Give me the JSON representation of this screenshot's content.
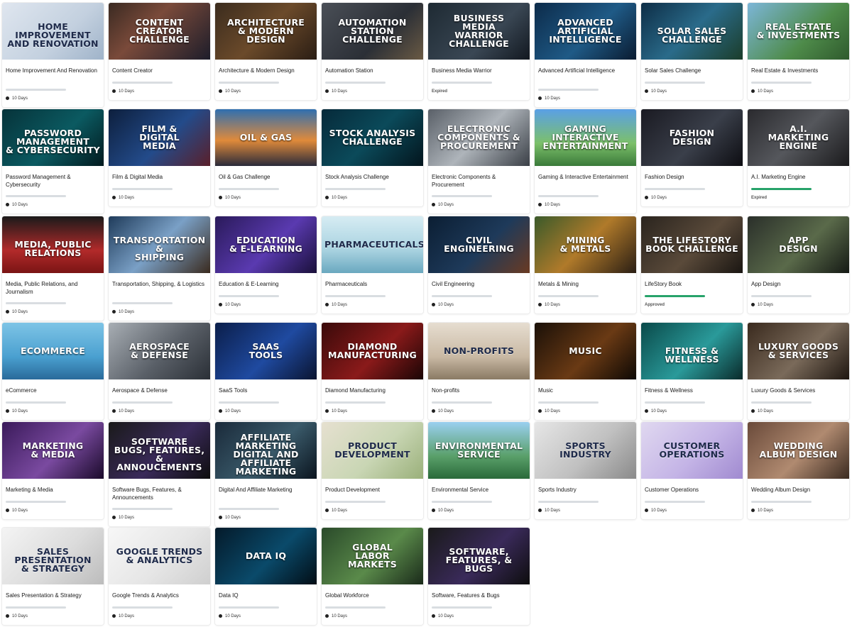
{
  "cards": [
    {
      "title": "Home Improvement And Renovation",
      "thumb": "Home Improvement\nand Renovation",
      "meta": "10 Days",
      "icon": "timer-icon",
      "progress": 0,
      "bg": "linear-gradient(135deg,#dfe6ef 0%,#c3d0df 60%,#9fb3c9 100%)",
      "dark": true
    },
    {
      "title": "Content Creator",
      "thumb": "Content\nCreator\nChallenge",
      "meta": "10 Days",
      "icon": "timer-icon",
      "progress": 0,
      "bg": "linear-gradient(135deg,#3a2a22 0%,#7a4a3a 40%,#1d1d2a 100%)"
    },
    {
      "title": "Architecture & Modern Design",
      "thumb": "Architecture\n& Modern\nDesign",
      "meta": "10 Days",
      "icon": "timer-icon",
      "progress": 0,
      "bg": "linear-gradient(135deg,#3b2c1e 0%,#6b4a2a 50%,#2a1d14 100%)"
    },
    {
      "title": "Automation Station",
      "thumb": "Automation\nStation\nChallenge",
      "meta": "10 Days",
      "icon": "timer-icon",
      "progress": 0,
      "bg": "linear-gradient(135deg,#4a4f57 0%,#2b2f36 60%,#6a5a44 100%)"
    },
    {
      "title": "Business Media Warrior",
      "thumb": "Business\nMedia\nWarrior\nChallenge",
      "meta": "Expired",
      "icon": "",
      "progress": 0,
      "bg": "linear-gradient(135deg,#1e2a33 0%,#3a4754 60%,#121820 100%)"
    },
    {
      "title": "Advanced Artificial Intelligence",
      "thumb": "Advanced\nArtificial\nIntelligence",
      "meta": "10 Days",
      "icon": "timer-icon",
      "progress": 0,
      "bg": "linear-gradient(135deg,#0c2b4a 0%,#1f5a86 55%,#0a1b30 100%)"
    },
    {
      "title": "Solar Sales Challenge",
      "thumb": "Solar Sales Challenge",
      "meta": "10 Days",
      "icon": "timer-icon",
      "progress": 0,
      "bg": "linear-gradient(135deg,#0d2d46 0%,#2a6b8a 50%,#1b3d2a 100%)"
    },
    {
      "title": "Real Estate & Investments",
      "thumb": "Real Estate\n& Investments",
      "meta": "10 Days",
      "icon": "timer-icon",
      "progress": 0,
      "bg": "linear-gradient(135deg,#7cb6d8 0%,#4e8b4a 60%,#2f5a2d 100%)"
    },
    {
      "title": "Password Management & Cybersecurity",
      "thumb": "Password Management\n& Cybersecurity",
      "meta": "10 Days",
      "icon": "timer-icon",
      "progress": 0,
      "bg": "linear-gradient(135deg,#06333a 0%,#0b5a61 55%,#021a1e 100%)"
    },
    {
      "title": "Film & Digital Media",
      "thumb": "Film &\nDigital\nMedia",
      "meta": "10 Days",
      "icon": "timer-icon",
      "progress": 0,
      "bg": "linear-gradient(135deg,#0d1f3d 0%,#234b8a 55%,#5a1f2a 100%)"
    },
    {
      "title": "Oil & Gas Challenge",
      "thumb": "Oil & Gas",
      "meta": "10 Days",
      "icon": "timer-icon",
      "progress": 0,
      "bg": "linear-gradient(180deg,#2f6fb0 0%,#e08a3a 55%,#2a2a3a 100%)"
    },
    {
      "title": "Stock Analysis Challenge",
      "thumb": "Stock Analysis\nChallenge",
      "meta": "10 Days",
      "icon": "timer-icon",
      "progress": 0,
      "bg": "linear-gradient(135deg,#062a3a 0%,#0b4a5a 50%,#03151d 100%)"
    },
    {
      "title": "Electronic Components & Procurement",
      "thumb": "Electronic\nComponents &\nProcurement",
      "meta": "10 Days",
      "icon": "timer-icon",
      "progress": 0,
      "bg": "linear-gradient(135deg,#5a6068 0%,#aeb4ba 50%,#3a3f46 100%)"
    },
    {
      "title": "Gaming & Interactive Entertainment",
      "thumb": "Gaming\nInteractive\nEntertainment",
      "meta": "10 Days",
      "icon": "timer-icon",
      "progress": 0,
      "bg": "linear-gradient(180deg,#5aa0e6 0%,#7cc06a 60%,#3a7a3a 100%)"
    },
    {
      "title": "Fashion Design",
      "thumb": "Fashion\nDesign",
      "meta": "10 Days",
      "icon": "timer-icon",
      "progress": 0,
      "bg": "linear-gradient(135deg,#1a1a22 0%,#3a3f4a 55%,#0d0d12 100%)"
    },
    {
      "title": "A.I. Marketing Engine",
      "thumb": "A.I.\nMarketing\nEngine",
      "meta": "Expired",
      "icon": "",
      "progress": 1,
      "bg": "linear-gradient(135deg,#2a2a2e 0%,#55575c 50%,#1a1a1c 100%)"
    },
    {
      "title": "Media, Public Relations, and Journalism",
      "thumb": "Media, Public Relations",
      "meta": "10 Days",
      "icon": "timer-icon",
      "progress": 0,
      "bg": "linear-gradient(180deg,#1a1a1a 0%,#b22a2a 60%,#7a1414 100%)"
    },
    {
      "title": "Transportation, Shipping, & Logistics",
      "thumb": "Transportation &\nShipping",
      "meta": "10 Days",
      "icon": "timer-icon",
      "progress": 0,
      "bg": "linear-gradient(135deg,#1f3b5a 0%,#7aa0c6 50%,#3a2a1e 100%)"
    },
    {
      "title": "Education & E-Learning",
      "thumb": "Education\n& E-Learning",
      "meta": "10 Days",
      "icon": "timer-icon",
      "progress": 0,
      "bg": "linear-gradient(135deg,#2a1a5a 0%,#5a3ab0 55%,#1a103a 100%)"
    },
    {
      "title": "Pharmaceuticals",
      "thumb": "Pharmaceuticals",
      "meta": "10 Days",
      "icon": "timer-icon",
      "progress": 0,
      "bg": "linear-gradient(180deg,#d6ecf3 0%,#a8d2e0 60%,#6aa8bf 100%)",
      "dark": true
    },
    {
      "title": "Civil Engineering",
      "thumb": "Civil\nEngineering",
      "meta": "10 Days",
      "icon": "timer-icon",
      "progress": 0,
      "bg": "linear-gradient(135deg,#0b1e33 0%,#1e3a5a 55%,#6a3a22 100%)"
    },
    {
      "title": "Metals & Mining",
      "thumb": "Mining\n& Metals",
      "meta": "10 Days",
      "icon": "timer-icon",
      "progress": 0,
      "bg": "linear-gradient(135deg,#3a5a2a 0%,#b07a2a 50%,#2a1e14 100%)"
    },
    {
      "title": "LifeStory Book",
      "thumb": "The LifeStory\nBook Challenge",
      "meta": "Approved",
      "icon": "",
      "progress": 1,
      "bg": "linear-gradient(135deg,#2a241e 0%,#5a4a3a 55%,#1a1612 100%)"
    },
    {
      "title": "App Design",
      "thumb": "App\nDesign",
      "meta": "10 Days",
      "icon": "timer-icon",
      "progress": 0,
      "bg": "linear-gradient(135deg,#2a2f2a 0%,#5a6a4a 55%,#151a15 100%)"
    },
    {
      "title": "eCommerce",
      "thumb": "eCommerce",
      "meta": "10 Days",
      "icon": "timer-icon",
      "progress": 0,
      "bg": "linear-gradient(180deg,#7ec4e6 0%,#4aa0d0 60%,#2a6a9a 100%)"
    },
    {
      "title": "Aerospace & Defense",
      "thumb": "Aerospace\n& Defense",
      "meta": "10 Days",
      "icon": "timer-icon",
      "progress": 0,
      "bg": "linear-gradient(135deg,#a8aeb4 0%,#5a6068 55%,#2a2f36 100%)"
    },
    {
      "title": "SaaS Tools",
      "thumb": "SaaS\nTools",
      "meta": "10 Days",
      "icon": "timer-icon",
      "progress": 0,
      "bg": "linear-gradient(135deg,#0b1e4a 0%,#1f4aa0 55%,#0a1430 100%)"
    },
    {
      "title": "Diamond Manufacturing",
      "thumb": "Diamond\nManufacturing",
      "meta": "10 Days",
      "icon": "timer-icon",
      "progress": 0,
      "bg": "linear-gradient(135deg,#3a0a0a 0%,#8a1a1a 55%,#1a0505 100%)"
    },
    {
      "title": "Non-profits",
      "thumb": "Non-Profits",
      "meta": "10 Days",
      "icon": "timer-icon",
      "progress": 0,
      "bg": "linear-gradient(180deg,#e6ddd0 0%,#c9b9a4 60%,#8a7a64 100%)",
      "dark": true
    },
    {
      "title": "Music",
      "thumb": "Music",
      "meta": "10 Days",
      "icon": "timer-icon",
      "progress": 0,
      "bg": "linear-gradient(135deg,#1a1008 0%,#6a3a14 55%,#0d0804 100%)"
    },
    {
      "title": "Fitness & Wellness",
      "thumb": "Fitness & Wellness",
      "meta": "10 Days",
      "icon": "timer-icon",
      "progress": 0,
      "bg": "linear-gradient(135deg,#0a4a4a 0%,#2a9a9a 55%,#0a2a2a 100%)"
    },
    {
      "title": "Luxury Goods & Services",
      "thumb": "Luxury Goods\n& Services",
      "meta": "10 Days",
      "icon": "timer-icon",
      "progress": 0,
      "bg": "linear-gradient(135deg,#3a2a1e 0%,#7a6a5a 55%,#1e1610 100%)"
    },
    {
      "title": "Marketing & Media",
      "thumb": "Marketing\n& Media",
      "meta": "10 Days",
      "icon": "timer-icon",
      "progress": 0,
      "bg": "linear-gradient(135deg,#3a1a5a 0%,#7a4aa0 55%,#1a0a2a 100%)"
    },
    {
      "title": "Software Bugs, Features, & Announcements",
      "thumb": "Software\nBugs, Features,\n& Annoucements",
      "meta": "10 Days",
      "icon": "timer-icon",
      "progress": 0,
      "bg": "linear-gradient(135deg,#1a1a1a 0%,#3a2a5a 55%,#0d0d0d 100%)"
    },
    {
      "title": "Digital And Affiliate Marketing",
      "thumb": "Affiliate\nMarketing\nDigital and Affiliate\nMarketing",
      "meta": "10 Days",
      "icon": "timer-icon",
      "progress": 0,
      "bg": "linear-gradient(135deg,#1a2a3a 0%,#3a5a6a 55%,#0a141e 100%)"
    },
    {
      "title": "Product Development",
      "thumb": "Product\nDevelopment",
      "meta": "10 Days",
      "icon": "timer-icon",
      "progress": 0,
      "bg": "linear-gradient(135deg,#e6e0d0 0%,#c9d6b4 55%,#9ab07a 100%)",
      "dark": true
    },
    {
      "title": "Environmental Service",
      "thumb": "Environmental\nService",
      "meta": "10 Days",
      "icon": "timer-icon",
      "progress": 0,
      "bg": "linear-gradient(180deg,#9ad0f0 0%,#5aa06a 60%,#2a6a3a 100%)"
    },
    {
      "title": "Sports Industry",
      "thumb": "Sports\nIndustry",
      "meta": "10 Days",
      "icon": "timer-icon",
      "progress": 0,
      "bg": "linear-gradient(135deg,#e6e6e6 0%,#c0c0c0 55%,#8a8a8a 100%)",
      "dark": true
    },
    {
      "title": "Customer Operations",
      "thumb": "Customer\nOperations",
      "meta": "10 Days",
      "icon": "timer-icon",
      "progress": 0,
      "bg": "linear-gradient(135deg,#e0d8f0 0%,#c4b4e6 55%,#a08ad0 100%)",
      "dark": true
    },
    {
      "title": "Wedding Album Design",
      "thumb": "Wedding\nAlbum Design",
      "meta": "10 Days",
      "icon": "timer-icon",
      "progress": 0,
      "bg": "linear-gradient(135deg,#6a4a3a 0%,#b08a70 55%,#3a2a20 100%)"
    },
    {
      "title": "Sales Presentation & Strategy",
      "thumb": "Sales Presentation\n& Strategy",
      "meta": "10 Days",
      "icon": "timer-icon",
      "progress": 0,
      "bg": "linear-gradient(135deg,#f4f4f4 0%,#dcdcdc 55%,#bcbcbc 100%)",
      "dark": true
    },
    {
      "title": "Google Trends & Analytics",
      "thumb": "Google Trends\n& Analytics",
      "meta": "10 Days",
      "icon": "timer-icon",
      "progress": 0,
      "bg": "linear-gradient(135deg,#f7f7f7 0%,#e6e6e6 55%,#cfcfcf 100%)",
      "dark": true
    },
    {
      "title": "Data IQ",
      "thumb": "Data IQ",
      "meta": "10 Days",
      "icon": "timer-icon",
      "progress": 0,
      "bg": "linear-gradient(135deg,#041a2a 0%,#0a4a6a 55%,#020d15 100%)"
    },
    {
      "title": "Global Workforce",
      "thumb": "Global\nLabor\nMarkets",
      "meta": "10 Days",
      "icon": "timer-icon",
      "progress": 0,
      "bg": "linear-gradient(135deg,#2a4a2a 0%,#5a8a4a 55%,#1a2a1a 100%)"
    },
    {
      "title": "Software, Features & Bugs",
      "thumb": "Software,\nFeatures, & Bugs",
      "meta": "10 Days",
      "icon": "timer-icon",
      "progress": 0,
      "bg": "linear-gradient(135deg,#1a1a1a 0%,#3a2a5a 55%,#0d0d0d 100%)"
    }
  ],
  "colors": {
    "progress": "#27a36a",
    "track": "#d9dde1"
  }
}
